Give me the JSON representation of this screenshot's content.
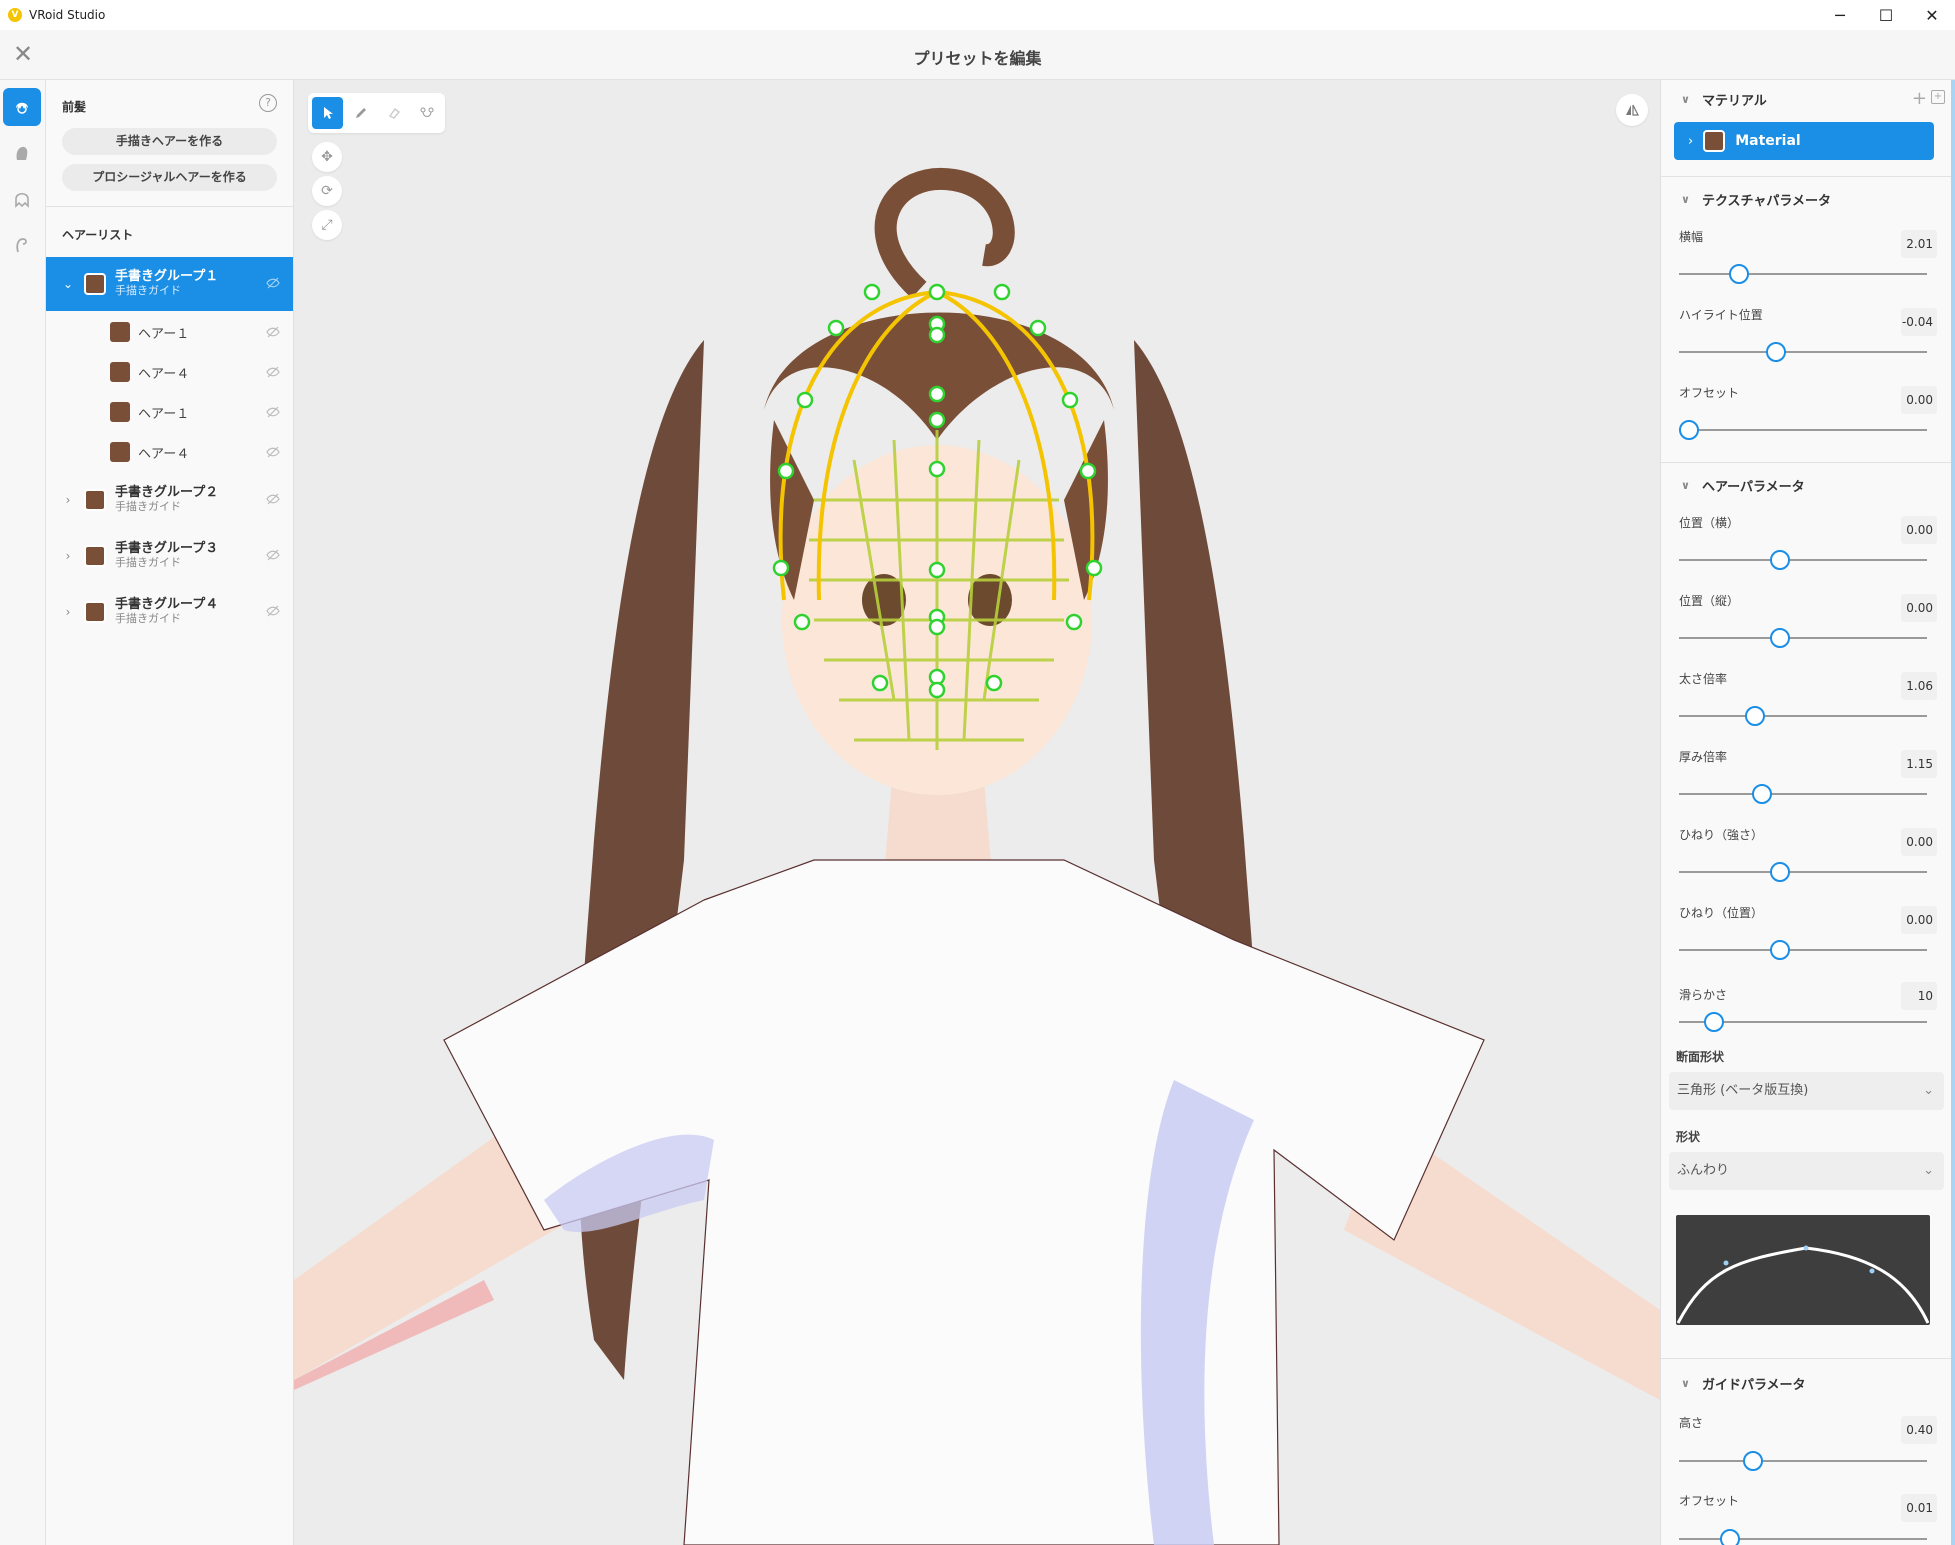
{
  "window": {
    "app_title": "VRoid Studio",
    "minimize": "─",
    "maximize": "☐",
    "close": "✕"
  },
  "header": {
    "title": "プリセットを編集",
    "close_icon": "✕"
  },
  "rail": {
    "items": [
      "hair-front-icon",
      "hair-base-icon",
      "hair-back-icon",
      "ahoge-icon"
    ]
  },
  "list_panel": {
    "heading": "前髪",
    "help": "?",
    "create_hand_button": "手描きヘアーを作る",
    "create_procedural_button": "プロシージャルヘアーを作る",
    "list_heading": "ヘアーリスト",
    "groups": [
      {
        "name": "手書きグループ１",
        "sub": "手描きガイド",
        "expanded": true,
        "selected": true
      },
      {
        "name": "手書きグループ２",
        "sub": "手描きガイド",
        "expanded": false,
        "selected": false
      },
      {
        "name": "手書きグループ３",
        "sub": "手描きガイド",
        "expanded": false,
        "selected": false
      },
      {
        "name": "手書きグループ４",
        "sub": "手描きガイド",
        "expanded": false,
        "selected": false
      }
    ],
    "children": [
      "ヘアー１",
      "ヘアー４",
      "ヘアー１",
      "ヘアー４"
    ],
    "swatch_color": "#7a4f38"
  },
  "viewport": {
    "tools": [
      "select-cursor-icon",
      "pen-icon",
      "eraser-icon",
      "curve-edit-icon"
    ],
    "view_tools": [
      "move-view-icon",
      "rotate-view-icon",
      "zoom-view-icon"
    ],
    "mirror_icon": "mirror-icon",
    "accent": "#1b8ee6"
  },
  "right_panel": {
    "material": {
      "heading": "マテリアル",
      "add": "+",
      "name": "Material"
    },
    "texture": {
      "heading": "テクスチャパラメータ",
      "params": [
        {
          "label": "横幅",
          "value": "2.01",
          "level": 0.22
        },
        {
          "label": "ハイライト位置",
          "value": "-0.04",
          "level": 0.38
        },
        {
          "label": "オフセット",
          "value": "0.00",
          "level": 0.0
        }
      ]
    },
    "hair": {
      "heading": "ヘアーパラメータ",
      "params": [
        {
          "label": "位置（横）",
          "value": "0.00",
          "level": 0.4
        },
        {
          "label": "位置（縦）",
          "value": "0.00",
          "level": 0.4
        },
        {
          "label": "太さ倍率",
          "value": "1.06",
          "level": 0.29
        },
        {
          "label": "厚み倍率",
          "value": "1.15",
          "level": 0.32
        },
        {
          "label": "ひねり（強さ）",
          "value": "0.00",
          "level": 0.4
        },
        {
          "label": "ひねり（位置）",
          "value": "0.00",
          "level": 0.4
        },
        {
          "label": "滑らかさ",
          "value": "10",
          "level": 0.11
        }
      ],
      "cross_section_label": "断面形状",
      "cross_section_value": "三角形 (ベータ版互換)",
      "shape_label": "形状",
      "shape_value": "ふんわり"
    },
    "guide": {
      "heading": "ガイドパラメータ",
      "params": [
        {
          "label": "高さ",
          "value": "0.40",
          "level": 0.28
        },
        {
          "label": "オフセット",
          "value": "0.01",
          "level": 0.18
        }
      ]
    }
  }
}
